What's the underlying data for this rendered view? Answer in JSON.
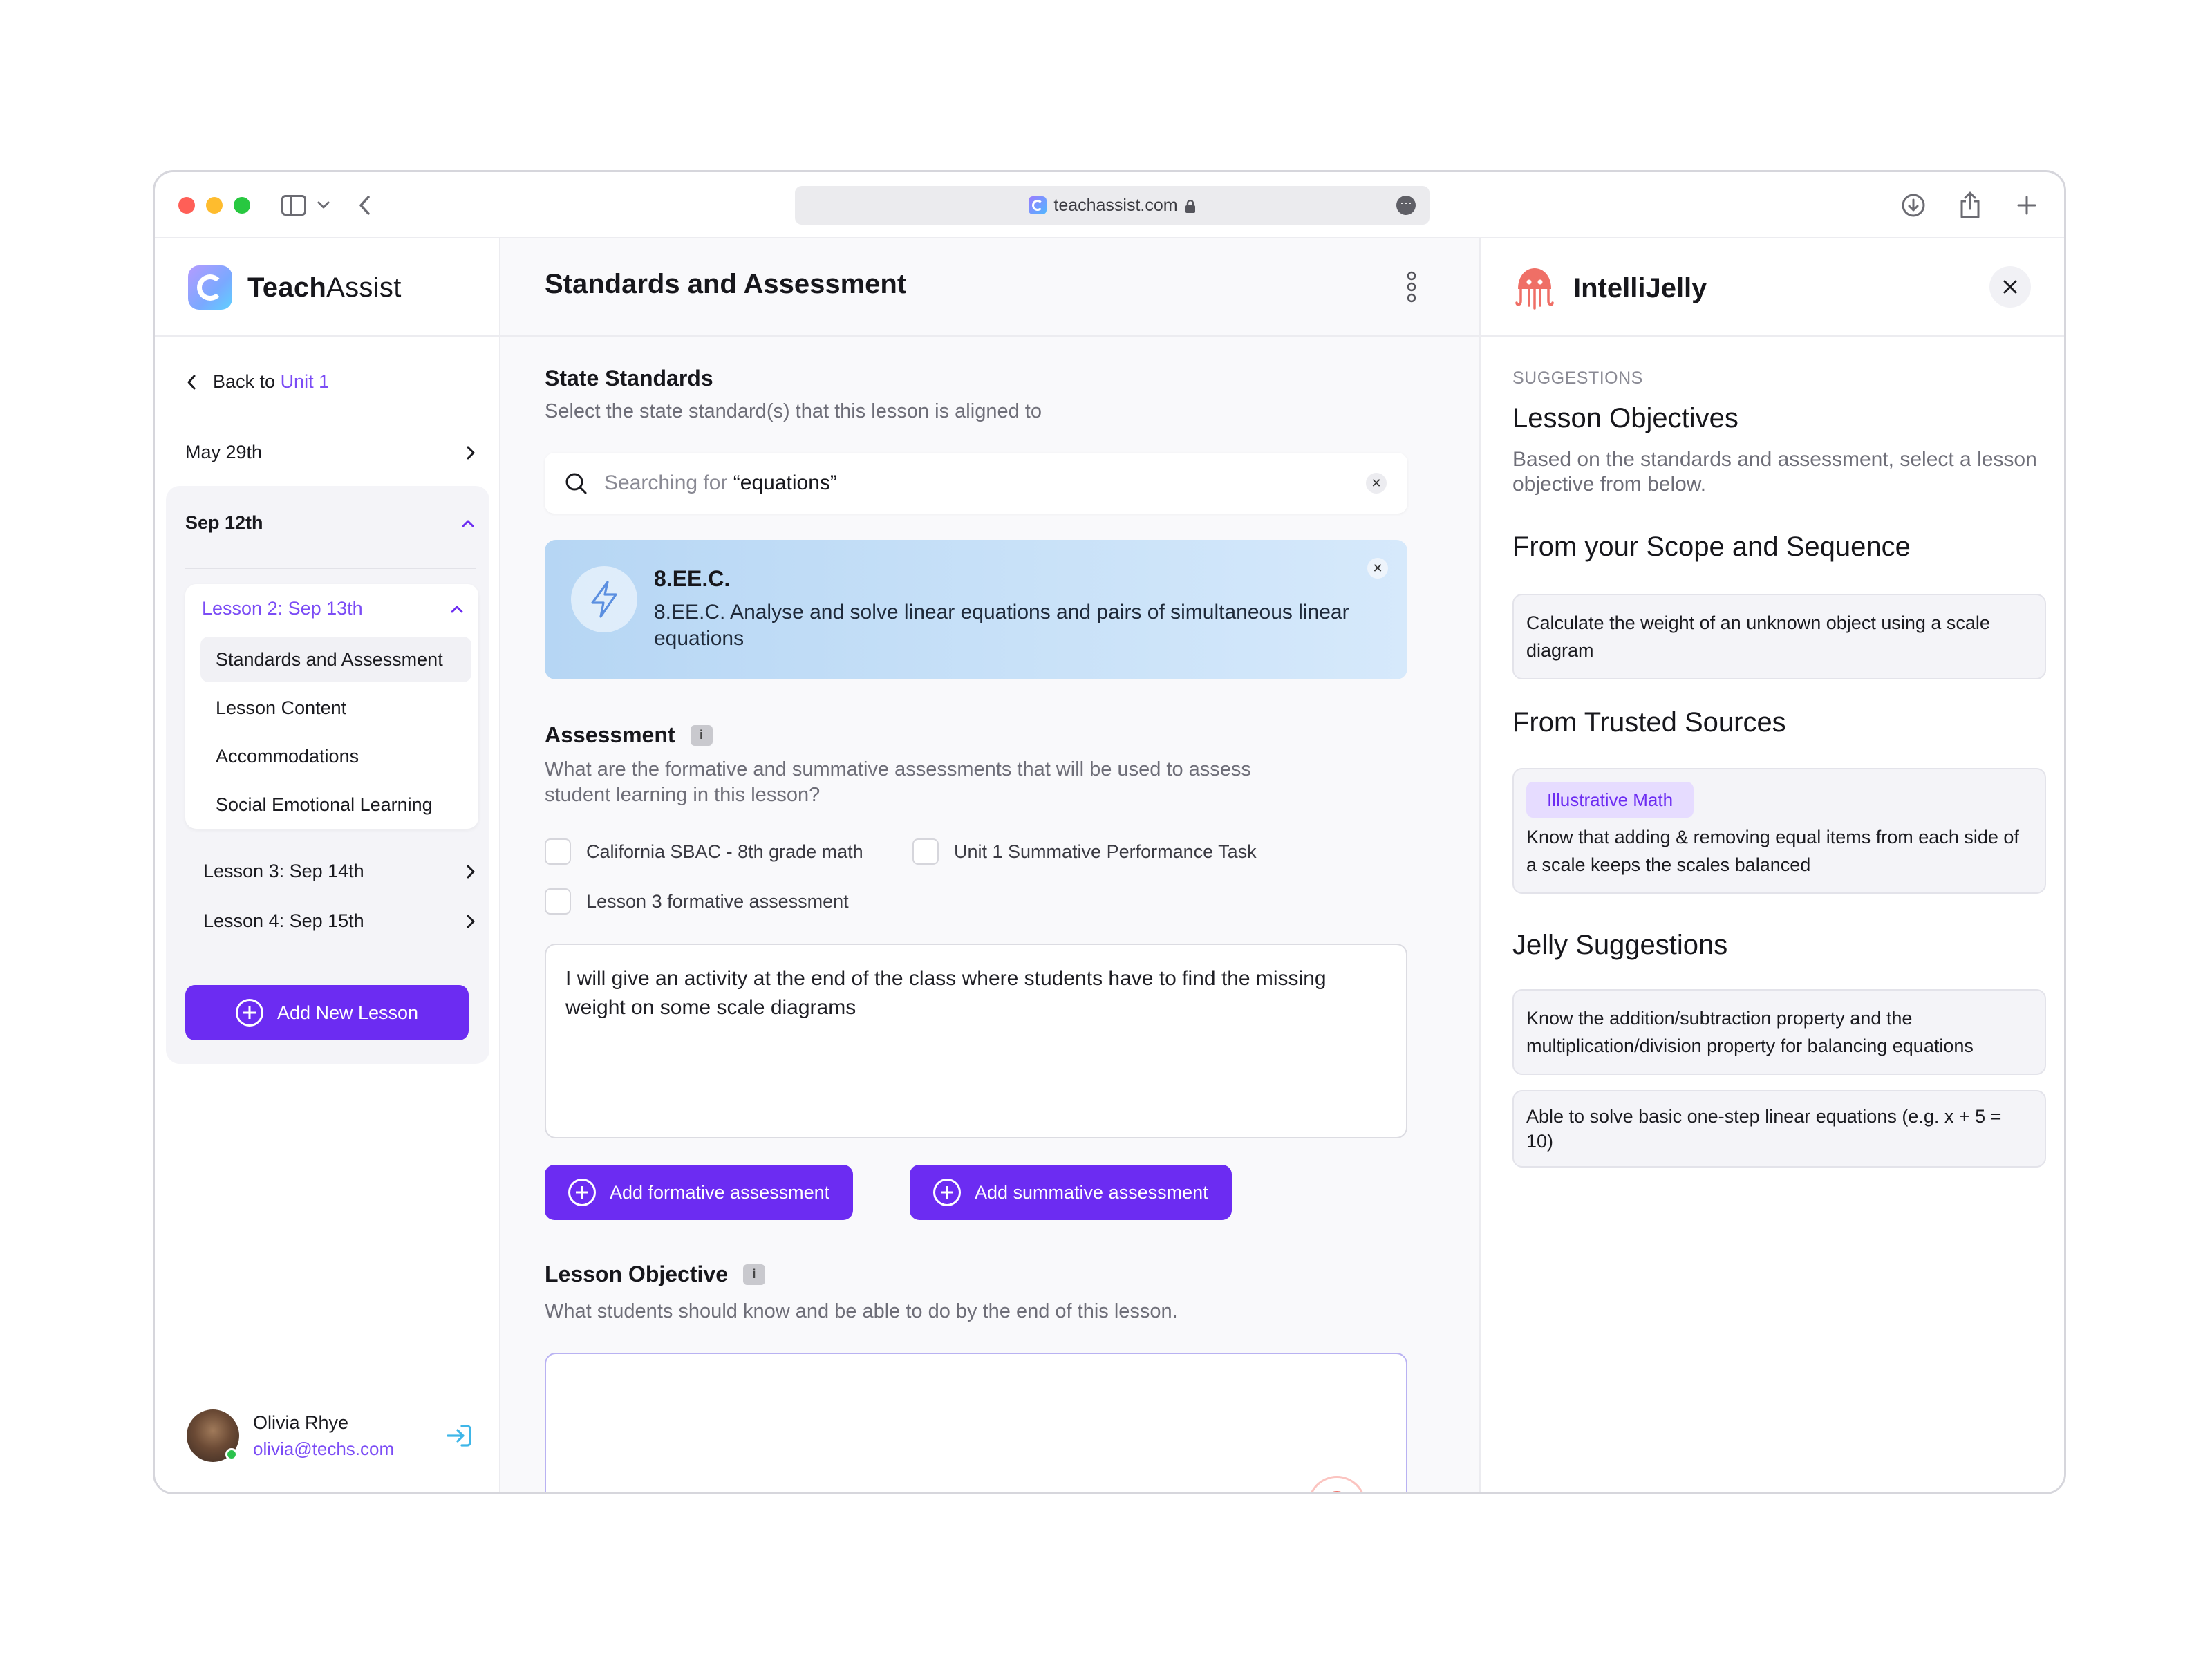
{
  "browser": {
    "url": "teachassist.com"
  },
  "app": {
    "brand_first": "Teach",
    "brand_second": "Assist"
  },
  "sidebar": {
    "back_prefix": "Back to",
    "back_unit": "Unit 1",
    "dates": [
      {
        "label": "May 29th",
        "expanded": false
      },
      {
        "label": "Sep 12th",
        "expanded": true
      }
    ],
    "current_lesson": "Lesson 2: Sep 13th",
    "sub_items": [
      {
        "label": "Standards and Assessment",
        "active": true
      },
      {
        "label": "Lesson Content",
        "active": false
      },
      {
        "label": "Accommodations",
        "active": false
      },
      {
        "label": "Social Emotional Learning",
        "active": false
      }
    ],
    "other_lessons": [
      "Lesson 3: Sep 14th",
      "Lesson 4: Sep 15th"
    ],
    "add_lesson_label": "Add New Lesson",
    "user": {
      "name": "Olivia Rhye",
      "email": "olivia@techs.com"
    }
  },
  "main": {
    "title": "Standards and Assessment",
    "state_standards": {
      "heading": "State Standards",
      "subtitle": "Select the state standard(s) that this lesson is aligned to",
      "search_prefix": "Searching for",
      "search_term": "“equations”",
      "selected": {
        "code": "8.EE.C.",
        "description": "8.EE.C. Analyse and solve linear equations and pairs of simultaneous linear equations"
      }
    },
    "assessment": {
      "heading": "Assessment",
      "info": "i",
      "subtitle": "What are the formative and summative assessments that will be used to assess student learning in this lesson?",
      "options": [
        {
          "label": "California SBAC - 8th grade math",
          "checked": false
        },
        {
          "label": "Unit 1 Summative Performance Task",
          "checked": false
        },
        {
          "label": "Lesson 3 formative assessment",
          "checked": false
        }
      ],
      "text": "I will give an activity at the end of the class where students have to find the missing weight on some scale diagrams",
      "add_formative": "Add formative assessment",
      "add_summative": "Add summative assessment"
    },
    "objective": {
      "heading": "Lesson Objective",
      "info": "i",
      "subtitle": "What students should know and be able to do by the end of this lesson.",
      "text": ""
    }
  },
  "assistant": {
    "name": "IntelliJelly",
    "suggestions_label": "SUGGESTIONS",
    "title": "Lesson Objectives",
    "subtitle": "Based on the standards and assessment, select a lesson objective from below.",
    "scope_heading": "From your Scope and Sequence",
    "scope_items": [
      "Calculate the weight of an unknown object using a scale diagram"
    ],
    "trusted_heading": "From Trusted Sources",
    "trusted_items": [
      {
        "tag": "Illustrative Math",
        "text": "Know that adding & removing equal items from each side of a scale keeps the scales balanced"
      }
    ],
    "jelly_heading": "Jelly Suggestions",
    "jelly_items": [
      "Know the addition/subtraction property and the multiplication/division property for balancing equations",
      "Able to solve basic one-step linear equations (e.g. x + 5 = 10)"
    ]
  },
  "colors": {
    "accent": "#6c2cf2",
    "standard_card": "#c8e1f8",
    "tag_bg": "#e6dcff",
    "online": "#2bc24d",
    "jelly": "#ef6f66"
  },
  "icons": [
    "sidebar-toggle-icon",
    "chevron-down-icon",
    "back-arrow-icon",
    "lock-icon",
    "more-icon",
    "download-icon",
    "share-icon",
    "plus-icon",
    "chevron-left-icon",
    "chevron-right-icon",
    "chevron-up-icon",
    "plus-circle-icon",
    "logout-icon",
    "more-vertical-icon",
    "search-icon",
    "close-icon",
    "bolt-icon",
    "info-icon",
    "jellyfish-icon"
  ]
}
